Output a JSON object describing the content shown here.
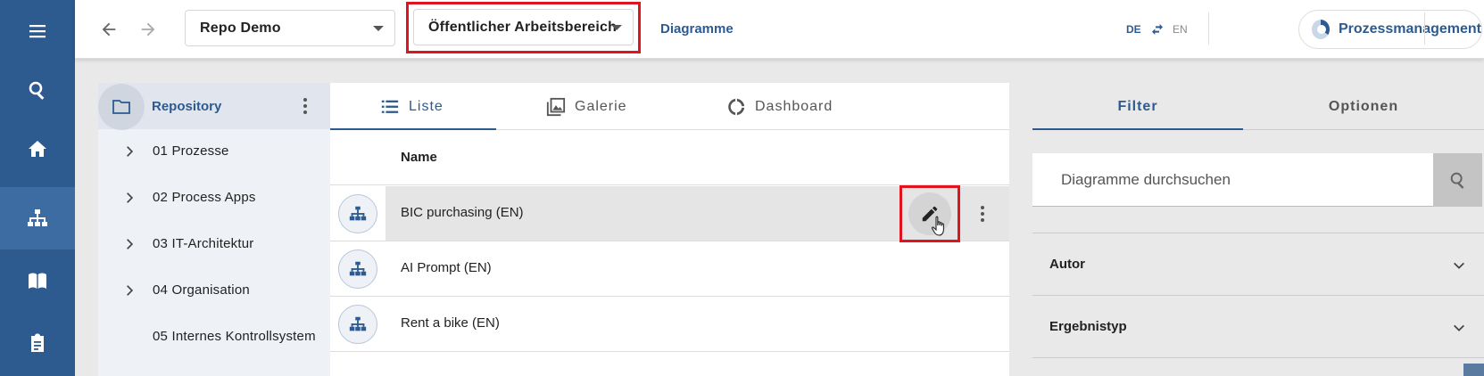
{
  "rail": {
    "items": [
      {
        "name": "menu-icon"
      },
      {
        "name": "search-icon"
      },
      {
        "name": "home-icon"
      },
      {
        "name": "sitemap-icon",
        "active": true
      },
      {
        "name": "book-icon"
      },
      {
        "name": "clipboard-icon"
      }
    ]
  },
  "topbar": {
    "repo_select": "Repo Demo",
    "workspace_select": "Öffentlicher Arbeitsbereich",
    "diagrams_link": "Diagramme",
    "lang_de": "DE",
    "lang_en": "EN",
    "process_button": "Prozessmanagement"
  },
  "tree": {
    "root_label": "Repository",
    "items": [
      {
        "label": "01 Prozesse",
        "expandable": true
      },
      {
        "label": "02 Process Apps",
        "expandable": true
      },
      {
        "label": "03 IT-Architektur",
        "expandable": true
      },
      {
        "label": "04 Organisation",
        "expandable": true
      },
      {
        "label": "05 Internes Kontrollsystem",
        "expandable": false
      }
    ]
  },
  "main": {
    "tabs": [
      {
        "label": "Liste",
        "icon": "list-icon",
        "active": true
      },
      {
        "label": "Galerie",
        "icon": "gallery-icon",
        "active": false
      },
      {
        "label": "Dashboard",
        "icon": "dashboard-icon",
        "active": false
      }
    ],
    "column_name": "Name",
    "rows": [
      {
        "name": "BIC purchasing (EN)",
        "selected": true
      },
      {
        "name": "AI Prompt (EN)",
        "selected": false
      },
      {
        "name": "Rent a bike (EN)",
        "selected": false
      }
    ]
  },
  "right": {
    "tabs": [
      {
        "label": "Filter",
        "active": true
      },
      {
        "label": "Optionen",
        "active": false
      }
    ],
    "search_placeholder": "Diagramme durchsuchen",
    "facets": [
      "Autor",
      "Ergebnistyp"
    ]
  },
  "colors": {
    "brand": "#2d5a8f",
    "highlight": "#e0141e"
  }
}
